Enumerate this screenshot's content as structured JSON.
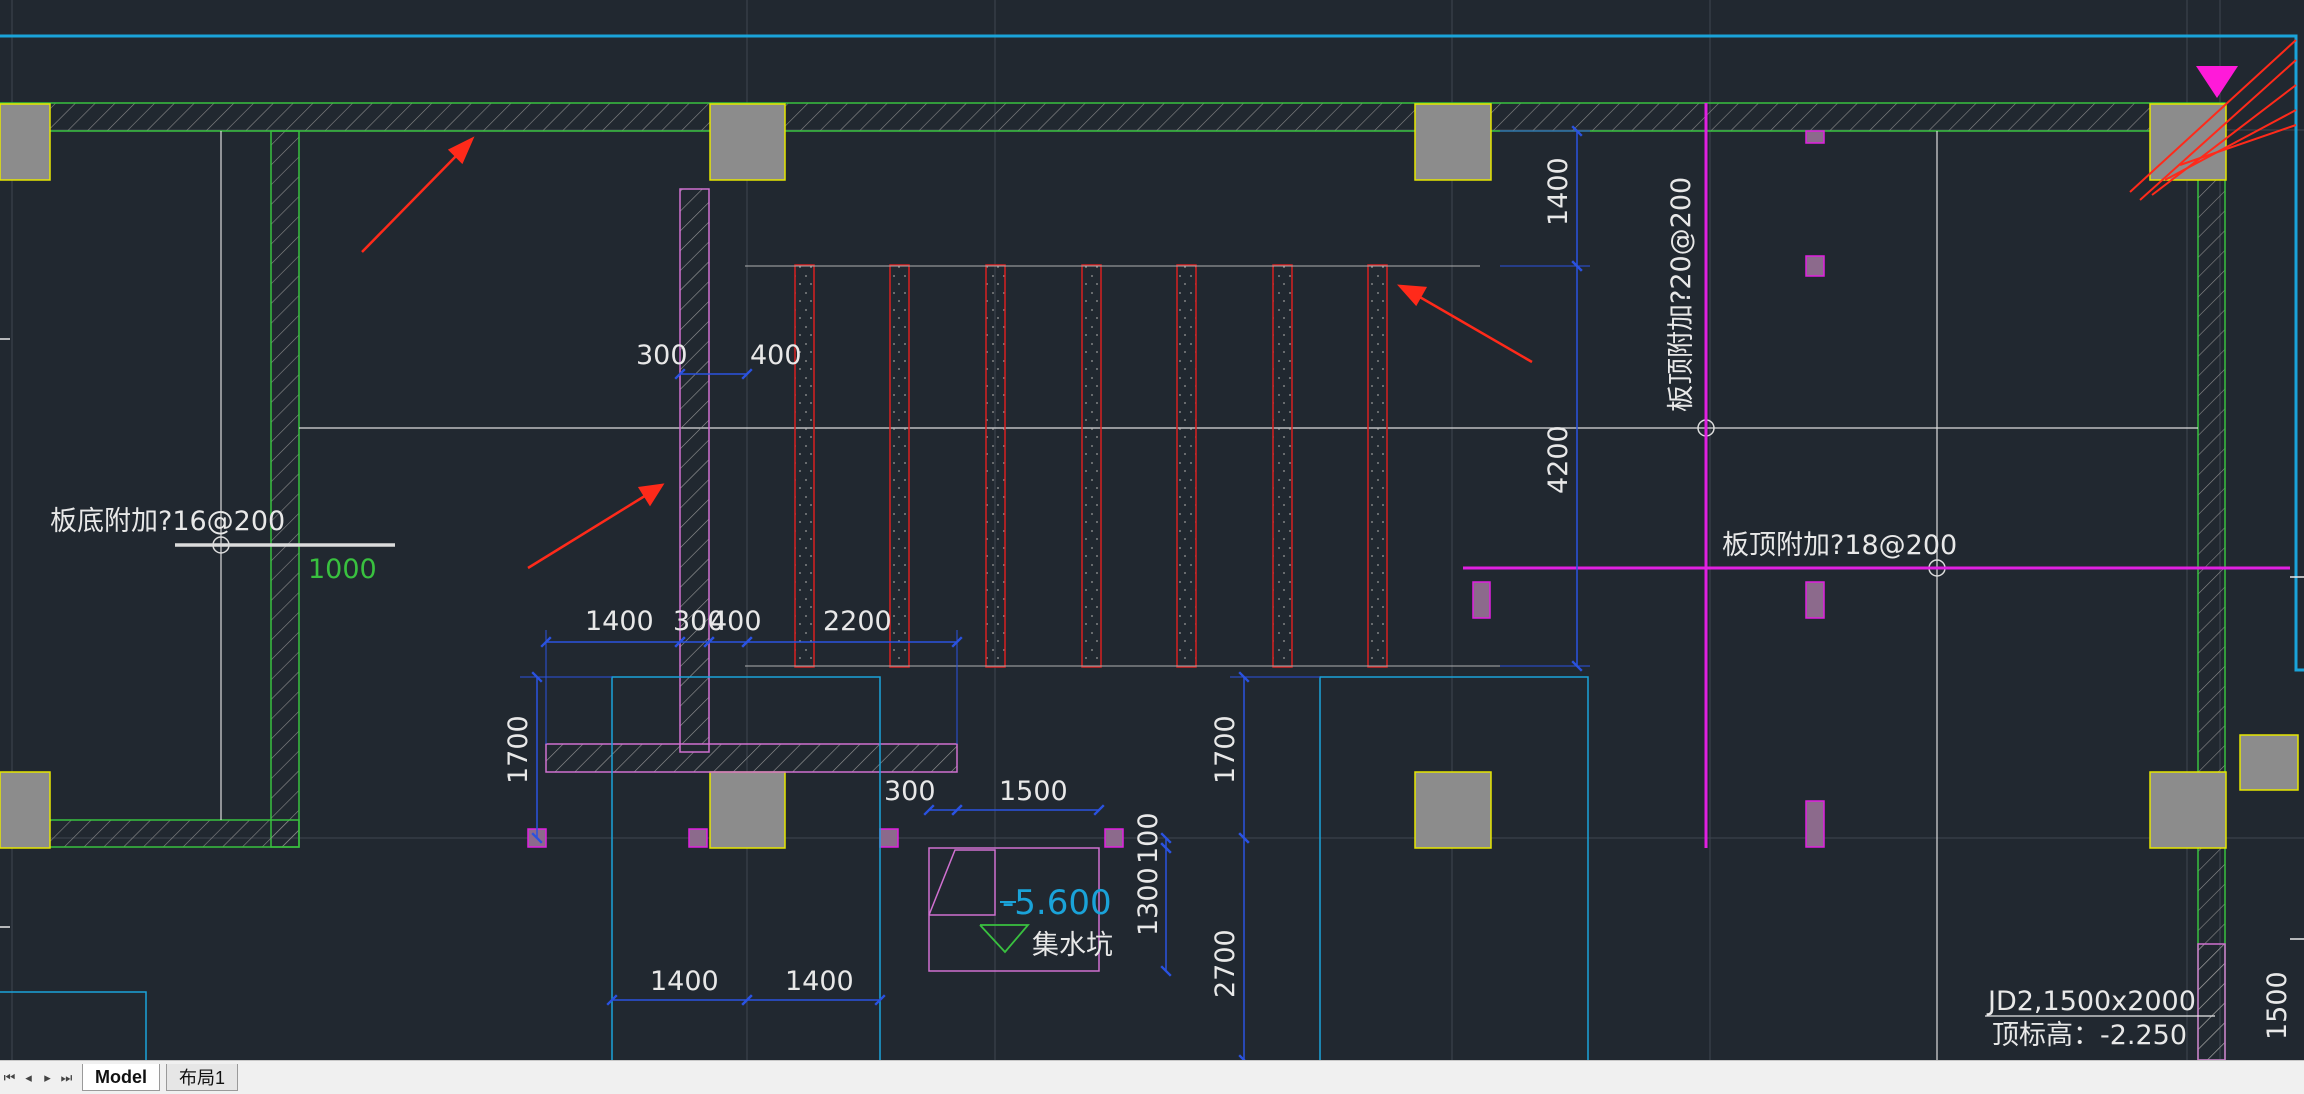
{
  "drawing": {
    "annotations": {
      "slab_bottom": "板底附加?16@200",
      "slab_top_vertical": "板顶附加?20@200",
      "slab_top_horizontal": "板顶附加?18@200",
      "offset_1000": "1000",
      "pit_elevation": "-5.600",
      "pit_label": "集水坑",
      "jd_size": "JD2,1500x2000",
      "top_elevation": "顶标高：-2.250"
    },
    "dimensions": {
      "d300_top": "300",
      "d400_top": "400",
      "d1400_vert": "1400",
      "d4200_vert": "4200",
      "d1400_row": "1400",
      "d300_row": "300",
      "d400_row": "400",
      "d2200_row": "2200",
      "d1700_left": "1700",
      "d300_pit": "300",
      "d1500_pit": "1500",
      "d1700_mid": "1700",
      "d100_pit": "100",
      "d1300_pit": "1300",
      "d2700": "2700",
      "d1400_bottom_a": "1400",
      "d1400_bottom_b": "1400",
      "d1500_right": "1500"
    },
    "colors": {
      "background": "#212830",
      "wall_green": "#39c13f",
      "column_gray": "#8c8c8c",
      "column_outline": "#e6e600",
      "magenta": "#e020e0",
      "cyan": "#1aa3d9",
      "dimension_blue": "#2a52e0",
      "text_white": "#e8e8e8",
      "red_arrow": "#ff2a1a",
      "rebar_red": "#d82020",
      "pink_outline": "#d070d0"
    }
  },
  "tabs": {
    "model_label": "Model",
    "layout1_label": "布局1"
  },
  "navigation": {
    "first_icon": "first-page-icon",
    "prev_icon": "prev-page-icon",
    "next_icon": "next-page-icon",
    "last_icon": "last-page-icon"
  }
}
